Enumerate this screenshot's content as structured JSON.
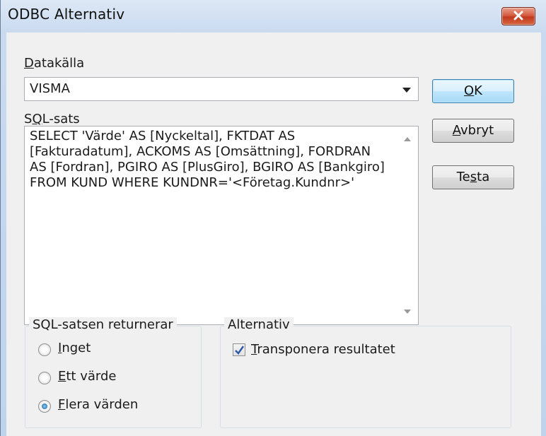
{
  "window": {
    "title": "ODBC Alternativ"
  },
  "datasource": {
    "label_underlined": "D",
    "label_rest": "atakälla",
    "value": "VISMA"
  },
  "sql": {
    "label_prefix": "S",
    "label_underlined": "Q",
    "label_rest": "L-sats",
    "text": "SELECT 'Värde' AS [Nyckeltal], FKTDAT AS [Fakturadatum], ACKOMS AS [Omsättning], FORDRAN AS [Fordran], PGIRO AS [PlusGiro], BGIRO AS [Bankgiro] FROM KUND WHERE KUNDNR='<Företag.Kundnr>'"
  },
  "buttons": {
    "ok": {
      "underlined": "O",
      "rest": "K"
    },
    "cancel": {
      "underlined": "A",
      "rest": "vbryt"
    },
    "test": {
      "prefix": "Te",
      "underlined": "s",
      "rest": "ta"
    }
  },
  "returns_group": {
    "legend": "SQL-satsen returnerar",
    "options": [
      {
        "underlined": "I",
        "rest": "nget",
        "selected": false
      },
      {
        "underlined": "E",
        "rest": "tt värde",
        "selected": false
      },
      {
        "underlined": "F",
        "rest": "lera värden",
        "selected": true
      }
    ]
  },
  "alternative_group": {
    "legend": "Alternativ",
    "checkbox": {
      "underlined": "T",
      "rest": "ransponera resultatet",
      "checked": true
    }
  },
  "colors": {
    "close_button": "#c1391f",
    "title_bar": "#c9daf0",
    "dialog_bg": "#f0f0f0"
  },
  "icons": {
    "close": "close-icon",
    "dropdown": "chevron-down-icon",
    "check": "checkmark-icon"
  }
}
